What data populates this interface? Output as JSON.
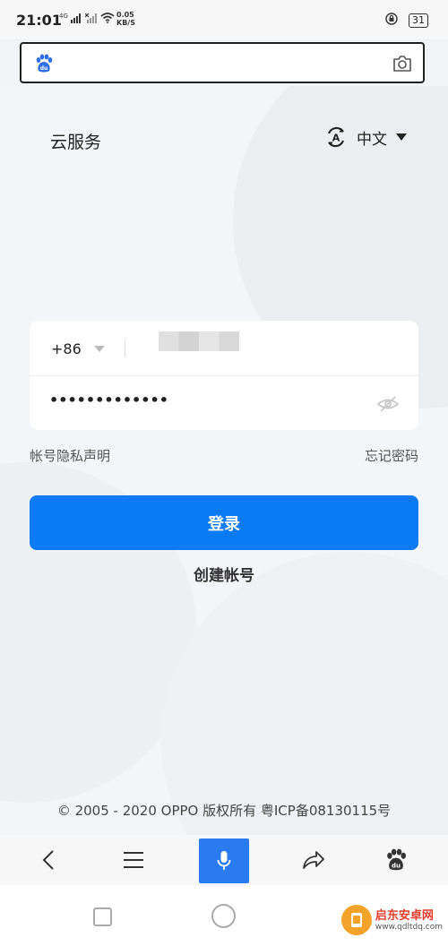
{
  "status_bar": {
    "time": "21:01",
    "network": "4G",
    "speed_value": "0.05",
    "speed_unit": "KB/S",
    "battery": "31"
  },
  "address_bar": {
    "site_icon": "baidu-paw-icon",
    "action_icon": "camera-icon"
  },
  "header": {
    "title": "云服务",
    "language": "中文",
    "language_icon": "translate-icon"
  },
  "login_form": {
    "country_code": "+86",
    "password_mask": "•••••••••••••",
    "visibility_icon": "eye-off-icon"
  },
  "links": {
    "privacy": "帐号隐私声明",
    "forgot_password": "忘记密码",
    "create_account": "创建帐号"
  },
  "login_button": "登录",
  "footer": {
    "copyright": "© 2005 - 2020 OPPO 版权所有 粤ICP备08130115号"
  },
  "toolbar": {
    "items": [
      "back-icon",
      "menu-icon",
      "mic-icon",
      "share-icon",
      "baidu-paw-icon"
    ]
  },
  "watermark": {
    "name": "启东安卓网",
    "url": "www.qdltdq.com"
  },
  "colors": {
    "primary": "#0a7af5",
    "mic": "#2a7af0",
    "text": "#222222"
  }
}
